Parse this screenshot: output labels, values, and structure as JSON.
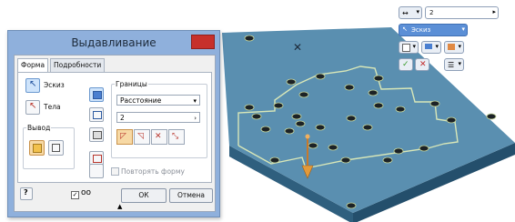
{
  "dialog": {
    "title": "Выдавливание",
    "close_glyph": "✕",
    "tabs": [
      {
        "label": "Форма",
        "active": true
      },
      {
        "label": "Подробности",
        "active": false
      }
    ],
    "profiles_label": "Эскиз",
    "solids_label": "Тела",
    "output_label": "Вывод",
    "extents_label": "Границы",
    "extents_type": "Расстояние",
    "distance_value": "2",
    "match_shape_label": "Повторять форму",
    "ok_label": "ОК",
    "cancel_label": "Отмена",
    "help_icon": "help-icon",
    "preview_icon": "glasses-icon",
    "preview_checked": true
  },
  "minitoolbar": {
    "distance_value": "2",
    "profile_label": "Эскиз"
  },
  "colors": {
    "dialog_frame": "#8fb0dc",
    "close_button": "#c7302b",
    "plate_top": "#5a8fb0",
    "sketch_line": "#d8e7b8",
    "accent_blue": "#5b8fd6"
  }
}
